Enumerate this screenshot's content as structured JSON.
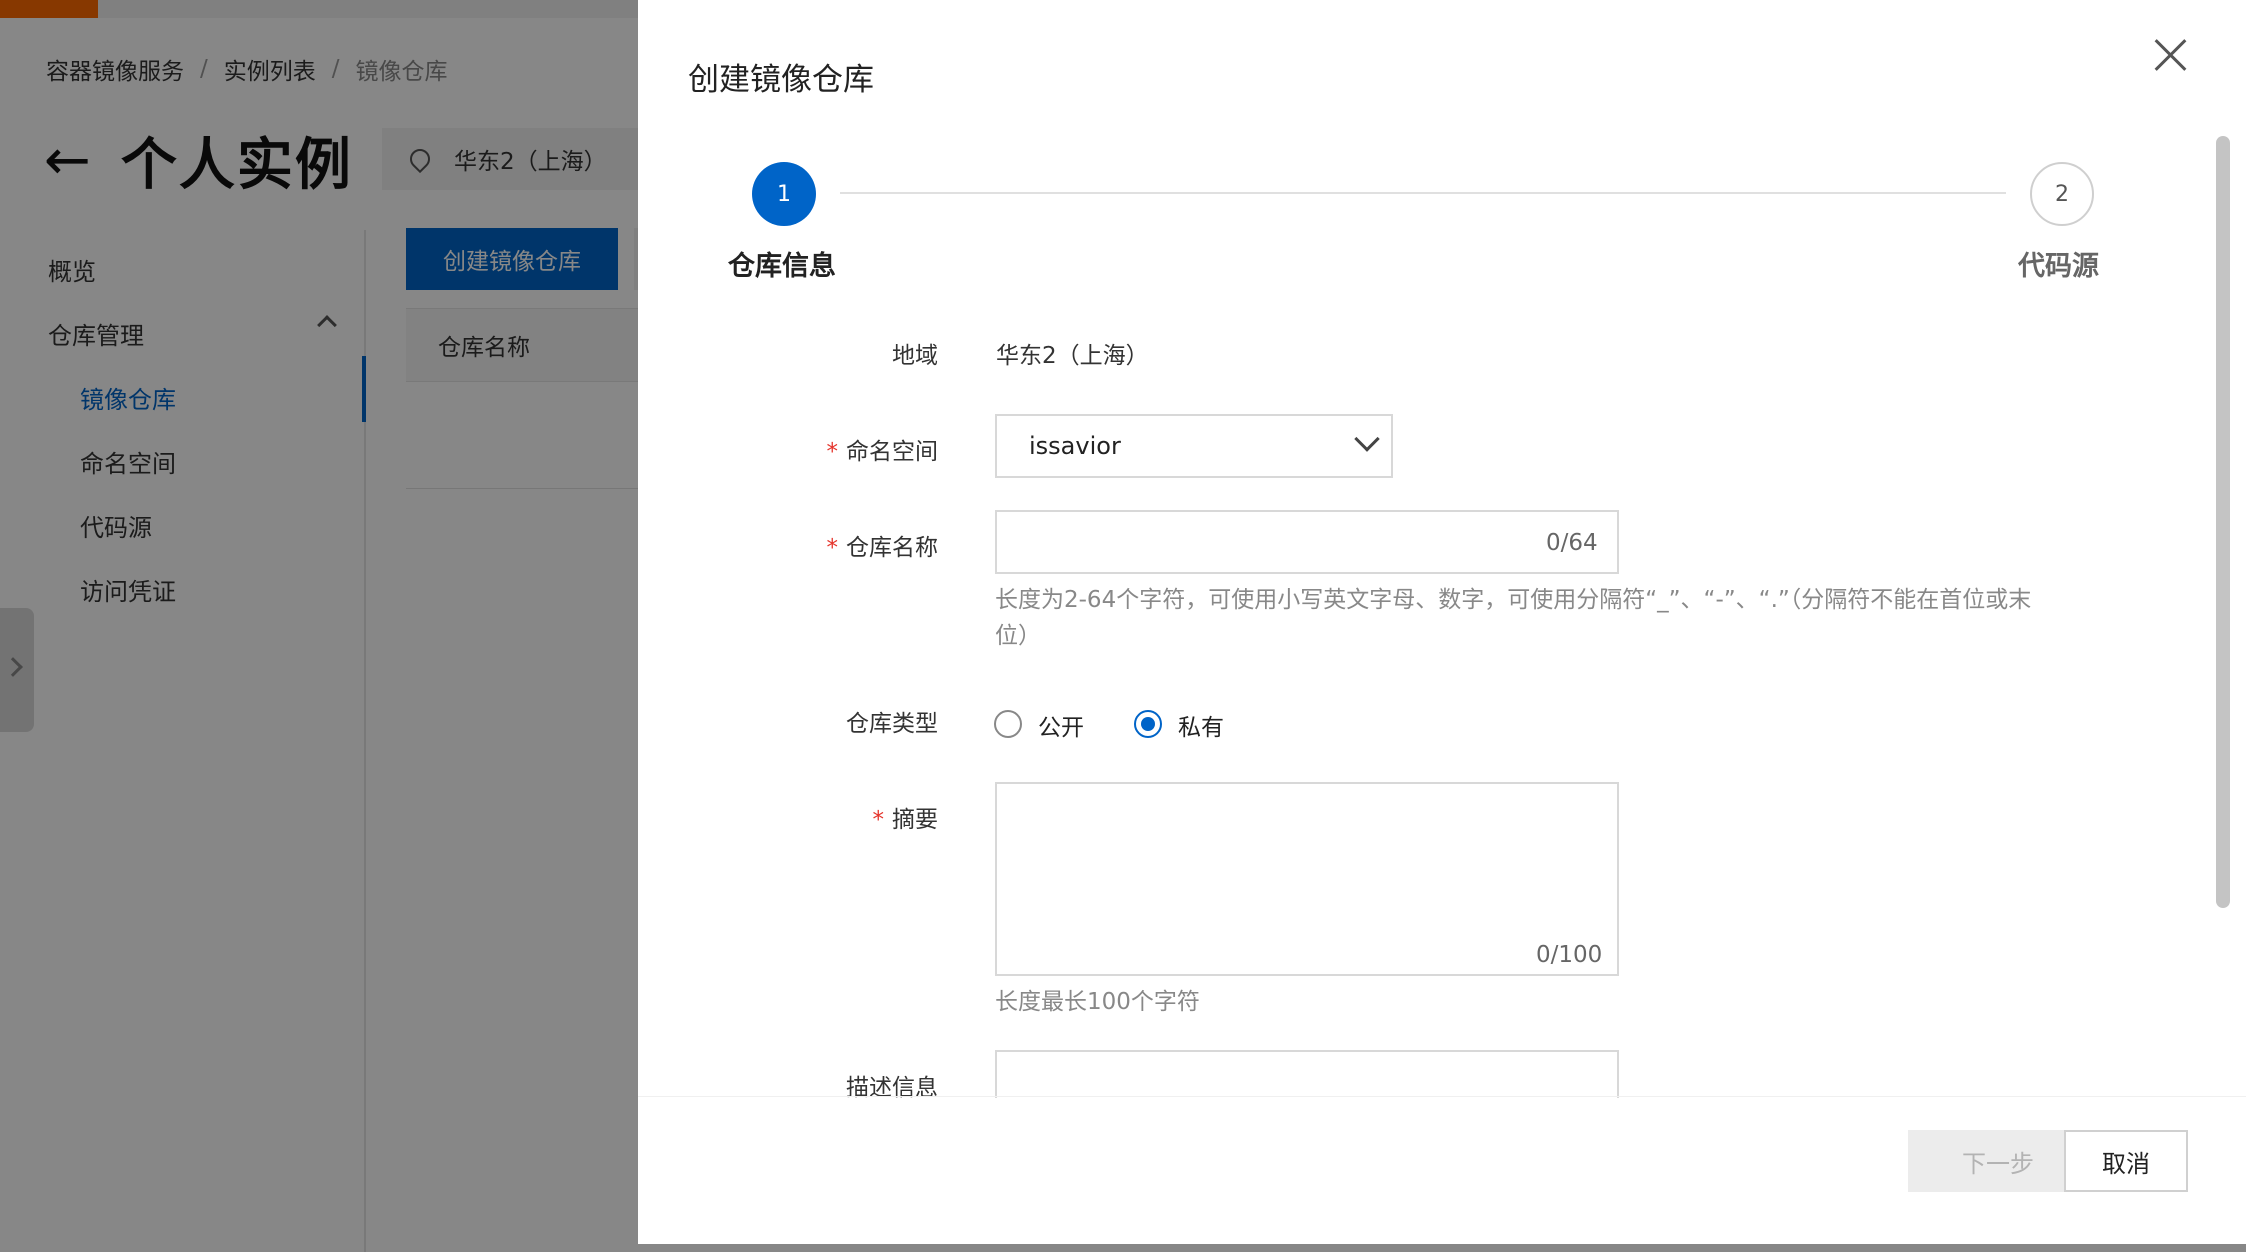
{
  "breadcrumb": {
    "item1": "容器镜像服务",
    "item2": "实例列表",
    "item3": "镜像仓库",
    "separator": "/"
  },
  "page": {
    "back_icon": "arrow-left-icon",
    "title": "个人实例",
    "region": "华东2（上海）"
  },
  "sidebar": {
    "items": [
      {
        "label": "概览"
      },
      {
        "label": "仓库管理"
      },
      {
        "label": "镜像仓库"
      },
      {
        "label": "命名空间"
      },
      {
        "label": "代码源"
      },
      {
        "label": "访问凭证"
      }
    ],
    "active_index": 2
  },
  "main": {
    "create_button": "创建镜像仓库",
    "table_header": "仓库名称"
  },
  "drawer": {
    "title": "创建镜像仓库",
    "steps": [
      {
        "number": "1",
        "label": "仓库信息"
      },
      {
        "number": "2",
        "label": "代码源"
      }
    ],
    "form": {
      "region_label": "地域",
      "region_value": "华东2（上海）",
      "namespace_label": "命名空间",
      "namespace_value": "issavior",
      "repo_name_label": "仓库名称",
      "repo_name_value": "",
      "repo_name_counter": "0/64",
      "repo_name_help": "长度为2-64个字符，可使用小写英文字母、数字，可使用分隔符“_”、“-”、“.”（分隔符不能在首位或末位）",
      "repo_type_label": "仓库类型",
      "repo_type_options": [
        "公开",
        "私有"
      ],
      "repo_type_selected": "私有",
      "summary_label": "摘要",
      "summary_counter": "0/100",
      "summary_help": "长度最长100个字符",
      "description_label": "描述信息",
      "required_mark": "*"
    },
    "buttons": {
      "next": "下一步",
      "cancel": "取消"
    }
  },
  "colors": {
    "primary": "#0064c8",
    "brand_accent": "#ff6a00",
    "required": "#e5342b"
  }
}
